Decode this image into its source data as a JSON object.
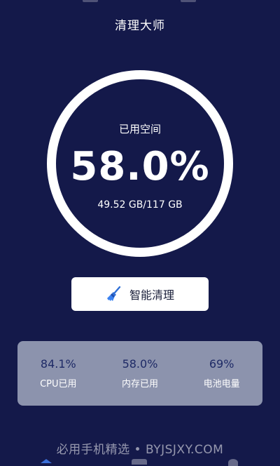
{
  "header": {
    "title": "清理大师"
  },
  "storage": {
    "label": "已用空间",
    "percent": "58.0%",
    "size": "49.52 GB/117 GB",
    "used_fraction": 0.58
  },
  "clean_button": {
    "label": "智能清理",
    "icon": "broom-icon"
  },
  "stats": [
    {
      "value": "84.1%",
      "label": "CPU已用"
    },
    {
      "value": "58.0%",
      "label": "内存已用"
    },
    {
      "value": "69%",
      "label": "电池电量"
    }
  ],
  "watermark": "必用手机精选 • BYJSJXY.COM",
  "bottom_nav": {
    "icons": [
      "home-icon",
      "toolbox-icon",
      "user-icon"
    ]
  },
  "colors": {
    "background": "#14194a",
    "ring": "#ffffff",
    "stats_panel": "#8c93ad",
    "stat_value": "#1e2a66",
    "accent": "#3a6fd8"
  }
}
